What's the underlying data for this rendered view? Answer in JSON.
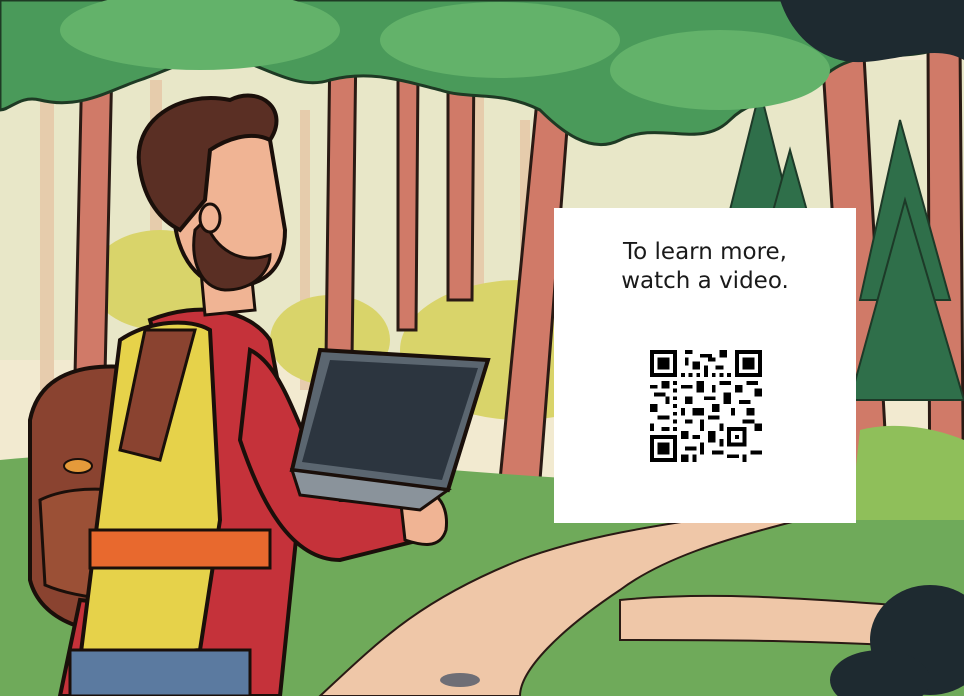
{
  "info_card": {
    "line1": "To learn more,",
    "line2": "watch a video.",
    "qr_icon": "qr-code"
  }
}
